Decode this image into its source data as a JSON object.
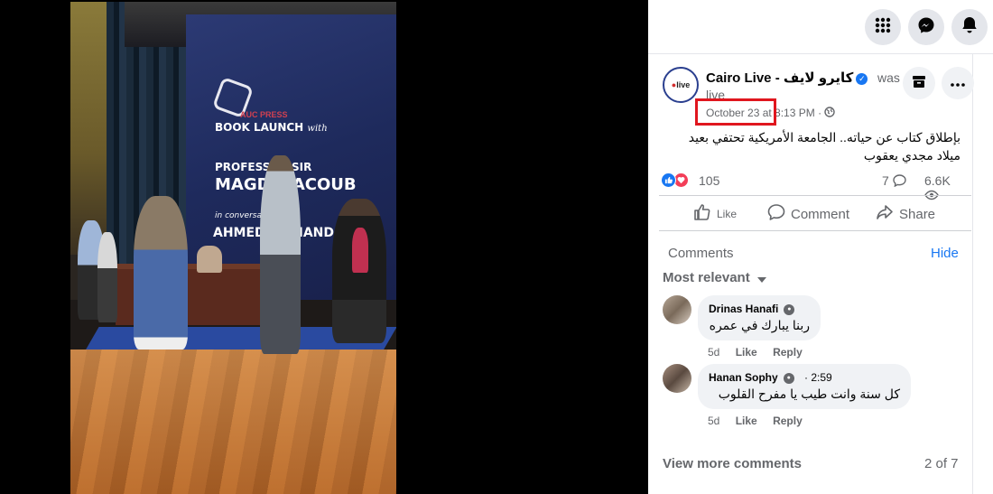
{
  "topbar": {
    "icons": [
      "menu-grid-icon",
      "messenger-icon",
      "notifications-bell-icon"
    ]
  },
  "post": {
    "page_name": "Cairo Live - كايرو لايف",
    "was_live_1": "was",
    "was_live_2": "live",
    "avatar_text": "live",
    "timestamp": "October 23 at 8:13 PM ·",
    "text": "بإطلاق كتاب عن حياته.. الجامعة الأمريكية تحتفي بعيد ميلاد مجدي يعقوب",
    "reaction_count": "105",
    "comment_count": "7",
    "view_count": "6.6K",
    "highlight_color": "#e0161e"
  },
  "actions": {
    "like": "Like",
    "comment": "Comment",
    "share": "Share"
  },
  "comments_section": {
    "label": "Comments",
    "hide": "Hide",
    "sort": "Most relevant",
    "view_more": "View more comments",
    "page_count": "2 of 7"
  },
  "comments": [
    {
      "name": "Drinas Hanafi",
      "text": "ربنا يبارك في عمره",
      "age": "5d",
      "like": "Like",
      "reply": "Reply"
    },
    {
      "name": "Hanan Sophy",
      "time": "2:59",
      "text": "كل سنة وانت طيب يا مفرح القلوب",
      "age": "5d",
      "like": "Like",
      "reply": "Reply"
    }
  ],
  "video": {
    "banner_line1": "BOOK LAUNCH",
    "banner_line1_suffix": "with",
    "banner_line2": "PROFESSOR SIR",
    "banner_line3": "MAGDI YACOUB",
    "banner_line4": "in conversation with",
    "banner_line5": "AHMED EL MANDOUR",
    "logo_text": "AUC PRESS"
  }
}
